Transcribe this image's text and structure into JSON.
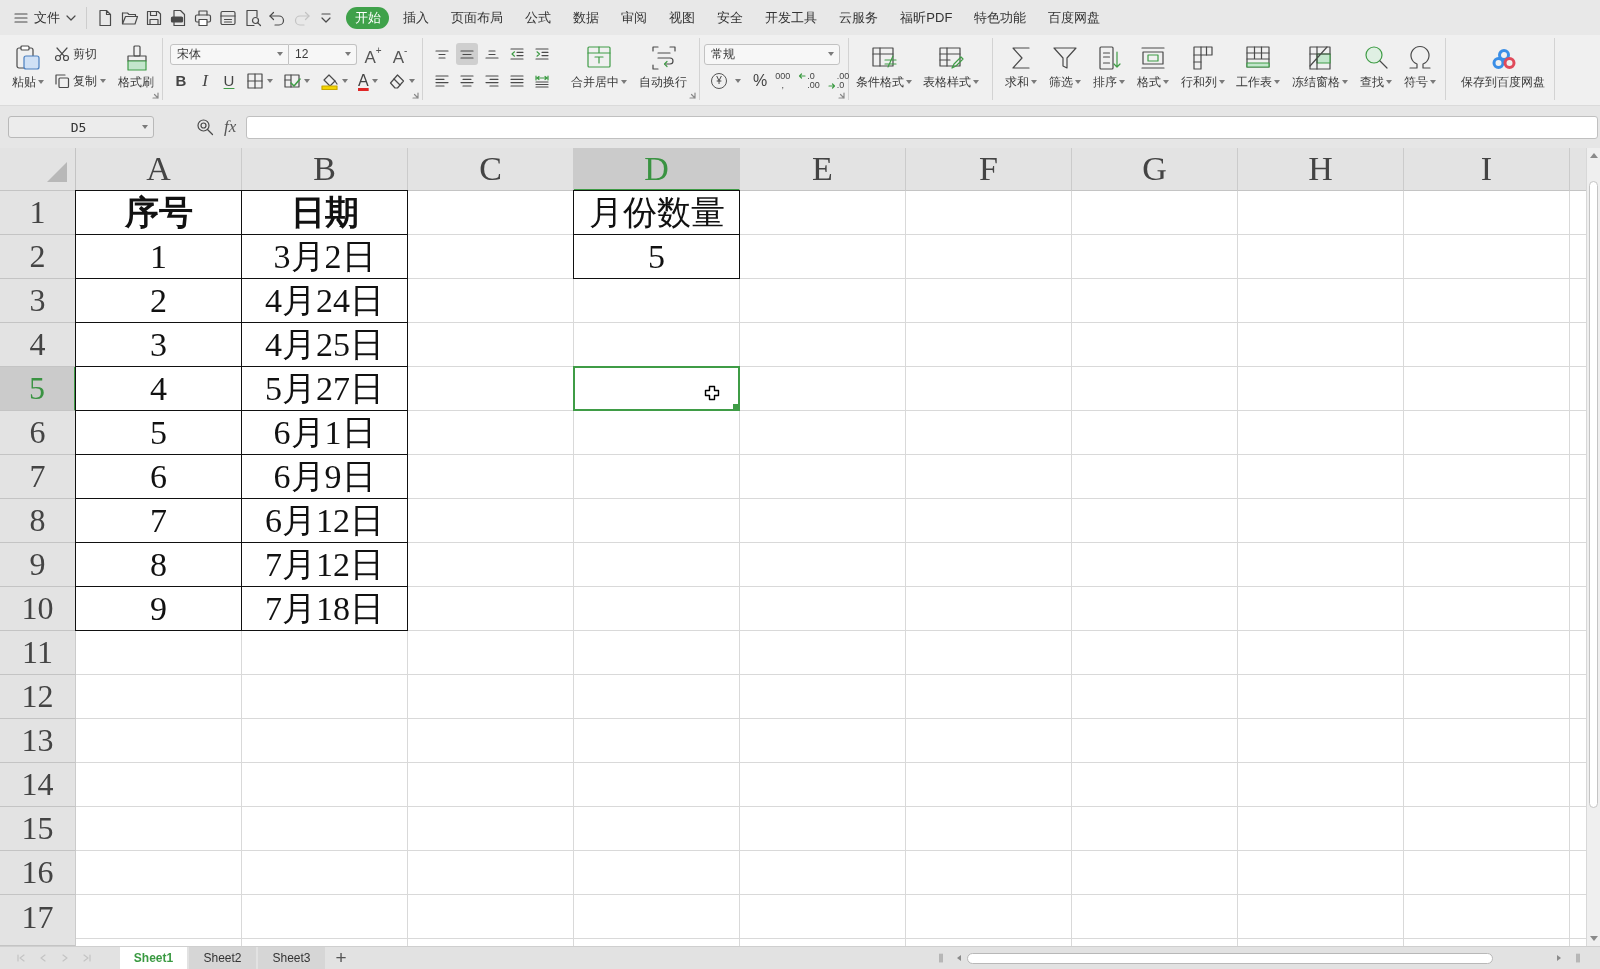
{
  "menu_bar": {
    "file_menu": "文件",
    "quick_access": [
      {
        "kind": "new",
        "disabled": false
      },
      {
        "kind": "open",
        "disabled": false
      },
      {
        "kind": "save",
        "disabled": false
      },
      {
        "kind": "export_pdf",
        "disabled": false
      },
      {
        "kind": "print",
        "disabled": false
      },
      {
        "kind": "print_preview",
        "disabled": false
      },
      {
        "kind": "find_preview",
        "disabled": false
      },
      {
        "kind": "undo",
        "disabled": false
      },
      {
        "kind": "redo",
        "disabled": true
      },
      {
        "kind": "customize",
        "disabled": false
      }
    ],
    "tabs": [
      {
        "label": "开始",
        "selected": true
      },
      {
        "label": "插入",
        "selected": false
      },
      {
        "label": "页面布局",
        "selected": false
      },
      {
        "label": "公式",
        "selected": false
      },
      {
        "label": "数据",
        "selected": false
      },
      {
        "label": "审阅",
        "selected": false
      },
      {
        "label": "视图",
        "selected": false
      },
      {
        "label": "安全",
        "selected": false
      },
      {
        "label": "开发工具",
        "selected": false
      },
      {
        "label": "云服务",
        "selected": false
      },
      {
        "label": "福昕PDF",
        "selected": false
      },
      {
        "label": "特色功能",
        "selected": false
      },
      {
        "label": "百度网盘",
        "selected": false
      }
    ]
  },
  "ribbon": {
    "clipboard": {
      "paste": "粘贴",
      "cut": "剪切",
      "copy": "复制",
      "format_painter": "格式刷"
    },
    "font": {
      "name": "宋体",
      "size": "12",
      "grow": "A$^{+}$",
      "shrink": "A$^{-}$",
      "styles": [
        {
          "kind": "bold",
          "label": "B"
        },
        {
          "kind": "italic",
          "label": "I"
        },
        {
          "kind": "underline",
          "label": "U"
        }
      ],
      "font_color": "A"
    },
    "alignment": {
      "vertical": [
        {
          "kind": "top",
          "selected": false
        },
        {
          "kind": "middle",
          "selected": true
        },
        {
          "kind": "bottom",
          "selected": false
        }
      ],
      "horizontal": [
        {
          "kind": "left",
          "selected": false
        },
        {
          "kind": "center",
          "selected": false
        },
        {
          "kind": "right",
          "selected": false
        },
        {
          "kind": "justify",
          "selected": false
        },
        {
          "kind": "distributed",
          "selected": false
        }
      ],
      "merge": "合并居中",
      "wrap": "自动换行"
    },
    "number": {
      "format": "常规",
      "currency": "¥",
      "percent": "%",
      "thousands": [
        "000",
        ","
      ],
      "increase_decimal": [
        ".0",
        ".00"
      ],
      "decrease_decimal": [
        ".00",
        ".0"
      ]
    },
    "styles": {
      "conditional": "条件格式",
      "table_style": "表格样式"
    },
    "tools": [
      {
        "kind": "sum",
        "label": "求和"
      },
      {
        "kind": "filter",
        "label": "筛选"
      },
      {
        "kind": "sort",
        "label": "排序"
      },
      {
        "kind": "format",
        "label": "格式"
      },
      {
        "kind": "rows_columns",
        "label": "行和列"
      },
      {
        "kind": "worksheet",
        "label": "工作表"
      },
      {
        "kind": "freeze",
        "label": "冻结窗格"
      },
      {
        "kind": "find",
        "label": "查找"
      },
      {
        "kind": "symbol",
        "label": "符号"
      }
    ],
    "cloud_save": "保存到百度网盘"
  },
  "formula_bar": {
    "name_box": "D5",
    "function_label": "fx"
  },
  "sheet": {
    "columns": [
      {
        "label": "A",
        "selected": false
      },
      {
        "label": "B",
        "selected": false
      },
      {
        "label": "C",
        "selected": false
      },
      {
        "label": "D",
        "selected": true
      },
      {
        "label": "E",
        "selected": false
      },
      {
        "label": "F",
        "selected": false
      },
      {
        "label": "G",
        "selected": false
      },
      {
        "label": "H",
        "selected": false
      },
      {
        "label": "I",
        "selected": false
      }
    ],
    "rows": [
      {
        "header": "1",
        "selected": false,
        "cells": [
          {
            "text": "序号",
            "bold": true,
            "bordered": true,
            "selected": false
          },
          {
            "text": "日期",
            "bold": true,
            "bordered": true,
            "selected": false
          },
          null,
          {
            "text": "月份数量",
            "bold": false,
            "bordered": true,
            "selected": false
          }
        ]
      },
      {
        "header": "2",
        "selected": false,
        "cells": [
          {
            "text": "1",
            "bold": false,
            "bordered": true,
            "selected": false
          },
          {
            "text": "3月2日",
            "bold": false,
            "bordered": true,
            "selected": false
          },
          null,
          {
            "text": "5",
            "bold": false,
            "bordered": true,
            "selected": false
          }
        ]
      },
      {
        "header": "3",
        "selected": false,
        "cells": [
          {
            "text": "2",
            "bold": false,
            "bordered": true,
            "selected": false
          },
          {
            "text": "4月24日",
            "bold": false,
            "bordered": true,
            "selected": false
          }
        ]
      },
      {
        "header": "4",
        "selected": false,
        "cells": [
          {
            "text": "3",
            "bold": false,
            "bordered": true,
            "selected": false
          },
          {
            "text": "4月25日",
            "bold": false,
            "bordered": true,
            "selected": false
          }
        ]
      },
      {
        "header": "5",
        "selected": true,
        "cells": [
          {
            "text": "4",
            "bold": false,
            "bordered": true,
            "selected": false
          },
          {
            "text": "5月27日",
            "bold": false,
            "bordered": true,
            "selected": false
          },
          null,
          {
            "bold": false,
            "bordered": false,
            "selected": true
          }
        ]
      },
      {
        "header": "6",
        "selected": false,
        "cells": [
          {
            "text": "5",
            "bold": false,
            "bordered": true,
            "selected": false
          },
          {
            "text": "6月1日",
            "bold": false,
            "bordered": true,
            "selected": false
          }
        ]
      },
      {
        "header": "7",
        "selected": false,
        "cells": [
          {
            "text": "6",
            "bold": false,
            "bordered": true,
            "selected": false
          },
          {
            "text": "6月9日",
            "bold": false,
            "bordered": true,
            "selected": false
          }
        ]
      },
      {
        "header": "8",
        "selected": false,
        "cells": [
          {
            "text": "7",
            "bold": false,
            "bordered": true,
            "selected": false
          },
          {
            "text": "6月12日",
            "bold": false,
            "bordered": true,
            "selected": false
          }
        ]
      },
      {
        "header": "9",
        "selected": false,
        "cells": [
          {
            "text": "8",
            "bold": false,
            "bordered": true,
            "selected": false
          },
          {
            "text": "7月12日",
            "bold": false,
            "bordered": true,
            "selected": false
          }
        ]
      },
      {
        "header": "10",
        "selected": false,
        "cells": [
          {
            "text": "9",
            "bold": false,
            "bordered": true,
            "selected": false
          },
          {
            "text": "7月18日",
            "bold": false,
            "bordered": true,
            "selected": false
          }
        ]
      },
      {
        "header": "11",
        "selected": false
      },
      {
        "header": "12",
        "selected": false
      },
      {
        "header": "13",
        "selected": false
      },
      {
        "header": "14",
        "selected": false
      },
      {
        "header": "15",
        "selected": false
      },
      {
        "header": "16",
        "selected": false
      },
      {
        "header": "17",
        "selected": false
      }
    ]
  },
  "sheet_tabs": {
    "tabs": [
      {
        "label": "Sheet1",
        "selected": true
      },
      {
        "label": "Sheet2",
        "selected": false
      },
      {
        "label": "Sheet3",
        "selected": false
      }
    ],
    "add_button": "+"
  }
}
